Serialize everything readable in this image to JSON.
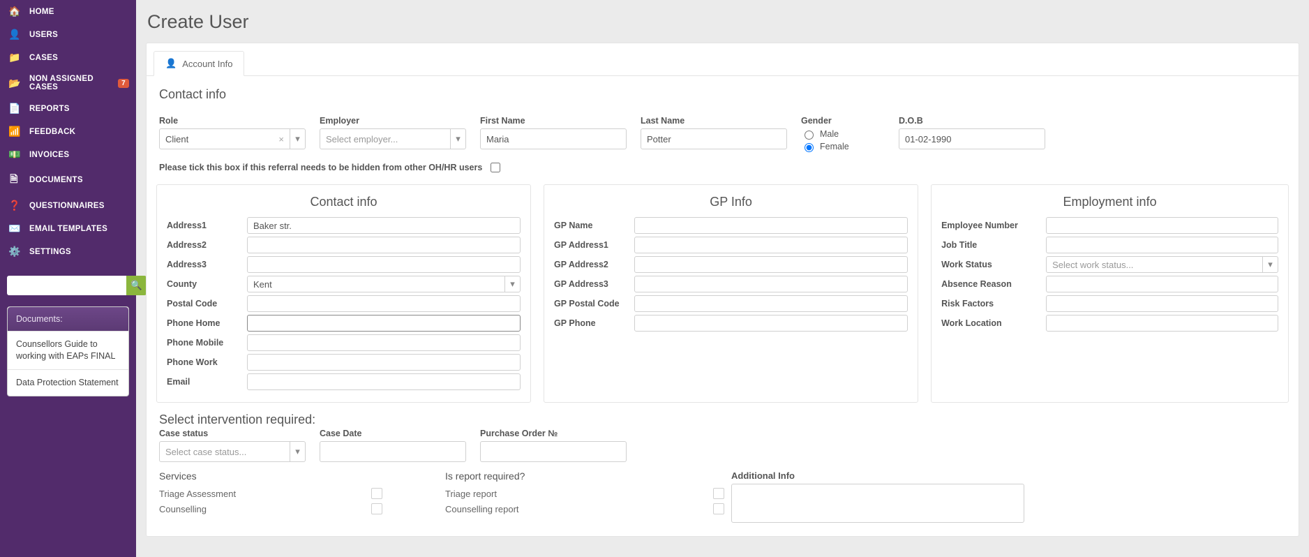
{
  "page": {
    "title": "Create User"
  },
  "sidebar": {
    "items": [
      {
        "label": "HOME"
      },
      {
        "label": "USERS"
      },
      {
        "label": "CASES"
      },
      {
        "label": "NON ASSIGNED CASES",
        "badge": "7"
      },
      {
        "label": "REPORTS"
      },
      {
        "label": "FEEDBACK"
      },
      {
        "label": "INVOICES"
      },
      {
        "label": "DOCUMENTS"
      },
      {
        "label": "QUESTIONNAIRES"
      },
      {
        "label": "EMAIL TEMPLATES"
      },
      {
        "label": "SETTINGS"
      }
    ],
    "search_placeholder": "",
    "documents_panel": {
      "title": "Documents:",
      "items": [
        "Counsellors Guide to working with EAPs FINAL",
        "Data Protection Statement"
      ]
    }
  },
  "tab": {
    "label": "Account Info"
  },
  "contact_top": {
    "section_title": "Contact info",
    "role_label": "Role",
    "role_value": "Client",
    "employer_label": "Employer",
    "employer_placeholder": "Select employer...",
    "first_name_label": "First Name",
    "first_name_value": "Maria",
    "last_name_label": "Last Name",
    "last_name_value": "Potter",
    "gender_label": "Gender",
    "gender_male": "Male",
    "gender_female": "Female",
    "gender_selected": "Female",
    "dob_label": "D.O.B",
    "dob_value": "01-02-1990",
    "hide_referral_text": "Please tick this box if this referral needs to be hidden from other OH/HR users"
  },
  "contact_panel": {
    "title": "Contact info",
    "address1_label": "Address1",
    "address1_value": "Baker str.",
    "address2_label": "Address2",
    "address3_label": "Address3",
    "county_label": "County",
    "county_value": "Kent",
    "postal_label": "Postal Code",
    "phone_home_label": "Phone Home",
    "phone_mobile_label": "Phone Mobile",
    "phone_work_label": "Phone Work",
    "email_label": "Email"
  },
  "gp_panel": {
    "title": "GP Info",
    "name_label": "GP Name",
    "addr1_label": "GP Address1",
    "addr2_label": "GP Address2",
    "addr3_label": "GP Address3",
    "postal_label": "GP Postal Code",
    "phone_label": "GP Phone"
  },
  "emp_panel": {
    "title": "Employment info",
    "empno_label": "Employee Number",
    "jobtitle_label": "Job Title",
    "workstatus_label": "Work Status",
    "workstatus_placeholder": "Select work status...",
    "absence_label": "Absence Reason",
    "risk_label": "Risk Factors",
    "loc_label": "Work Location"
  },
  "intervention": {
    "section_title": "Select intervention required:",
    "case_status_label": "Case status",
    "case_status_placeholder": "Select case status...",
    "case_date_label": "Case Date",
    "po_label": "Purchase Order №",
    "services_label": "Services",
    "report_label": "Is report required?",
    "services": [
      "Triage Assessment",
      "Counselling"
    ],
    "reports": [
      "Triage report",
      "Counselling report"
    ],
    "additional_label": "Additional Info"
  }
}
